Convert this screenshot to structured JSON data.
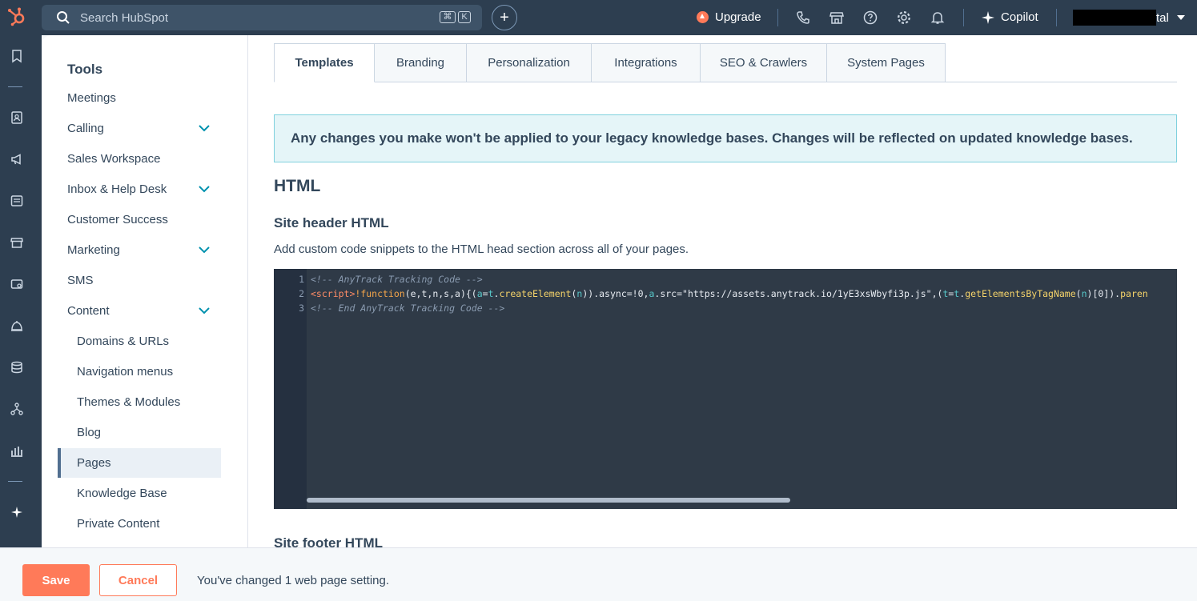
{
  "topbar": {
    "search_placeholder": "Search HubSpot",
    "shortcut_cmd": "⌘",
    "shortcut_key": "K",
    "upgrade_label": "Upgrade",
    "copilot_label": "Copilot",
    "account_tail": "tal",
    "icons": [
      "hubspot-logo",
      "search-icon",
      "plus-icon",
      "upgrade-icon",
      "phone-icon",
      "marketplace-icon",
      "help-icon",
      "settings-icon",
      "notifications-icon",
      "copilot-icon",
      "account-caret-icon"
    ]
  },
  "rail": {
    "icons": [
      "bookmark-icon",
      "contacts-icon",
      "marketing-icon",
      "content-icon",
      "commerce-icon",
      "sales-icon",
      "service-icon",
      "data-icon",
      "automation-icon",
      "reporting-icon",
      "ai-icon"
    ]
  },
  "sidebar": {
    "heading": "Tools",
    "items": [
      {
        "label": "Meetings",
        "expandable": false
      },
      {
        "label": "Calling",
        "expandable": true
      },
      {
        "label": "Sales Workspace",
        "expandable": false
      },
      {
        "label": "Inbox & Help Desk",
        "expandable": true
      },
      {
        "label": "Customer Success",
        "expandable": false
      },
      {
        "label": "Marketing",
        "expandable": true
      },
      {
        "label": "SMS",
        "expandable": false
      },
      {
        "label": "Content",
        "expandable": true
      }
    ],
    "content_children": [
      {
        "label": "Domains & URLs"
      },
      {
        "label": "Navigation menus"
      },
      {
        "label": "Themes & Modules"
      },
      {
        "label": "Blog"
      },
      {
        "label": "Pages",
        "active": true
      },
      {
        "label": "Knowledge Base"
      },
      {
        "label": "Private Content"
      }
    ]
  },
  "main": {
    "tabs": [
      {
        "label": "Templates",
        "active": true
      },
      {
        "label": "Branding"
      },
      {
        "label": "Personalization"
      },
      {
        "label": "Integrations"
      },
      {
        "label": "SEO & Crawlers"
      },
      {
        "label": "System Pages"
      }
    ],
    "alert_text": "Any changes you make won't be applied to your legacy knowledge bases. Changes will be reflected on updated knowledge bases.",
    "section_title": "HTML",
    "header_html_title": "Site header HTML",
    "header_html_desc": "Add custom code snippets to the HTML head section across all of your pages.",
    "code": {
      "line_numbers": [
        "1",
        "2",
        "3"
      ],
      "line1": "<!-- AnyTrack Tracking Code -->",
      "line2_parts": {
        "tag": "<script>",
        "bang_fn": "!function",
        "params": "(e,t,n,s,a){(",
        "a1": "a",
        "eq": "=",
        "t1": "t",
        "dot1": ".",
        "createElement": "createElement",
        "paren1": "(",
        "n1": "n",
        "close1": ")).async=!0,",
        "a2": "a",
        "src": ".src=",
        "url": "\"https://assets.anytrack.io/1yE3xsWbyfi3p.js\"",
        "comma": ",(",
        "t2": "t",
        "eq2": "=",
        "t3": "t",
        "dot2": ".",
        "getEl": "getElementsByTagName",
        "paren2": "(",
        "n2": "n",
        "close2": ")[0]).",
        "tail": "paren"
      },
      "line3": "<!-- End AnyTrack Tracking Code -->"
    },
    "footer_html_title": "Site footer HTML"
  },
  "savebar": {
    "save_label": "Save",
    "cancel_label": "Cancel",
    "status_text": "You've changed 1 web page setting."
  },
  "colors": {
    "nav_bg": "#2d3e50",
    "accent_orange": "#ff7a59",
    "alert_bg": "#e5f5f8",
    "alert_border": "#7fd1de",
    "editor_bg": "#2f3a47",
    "text": "#33475b"
  }
}
